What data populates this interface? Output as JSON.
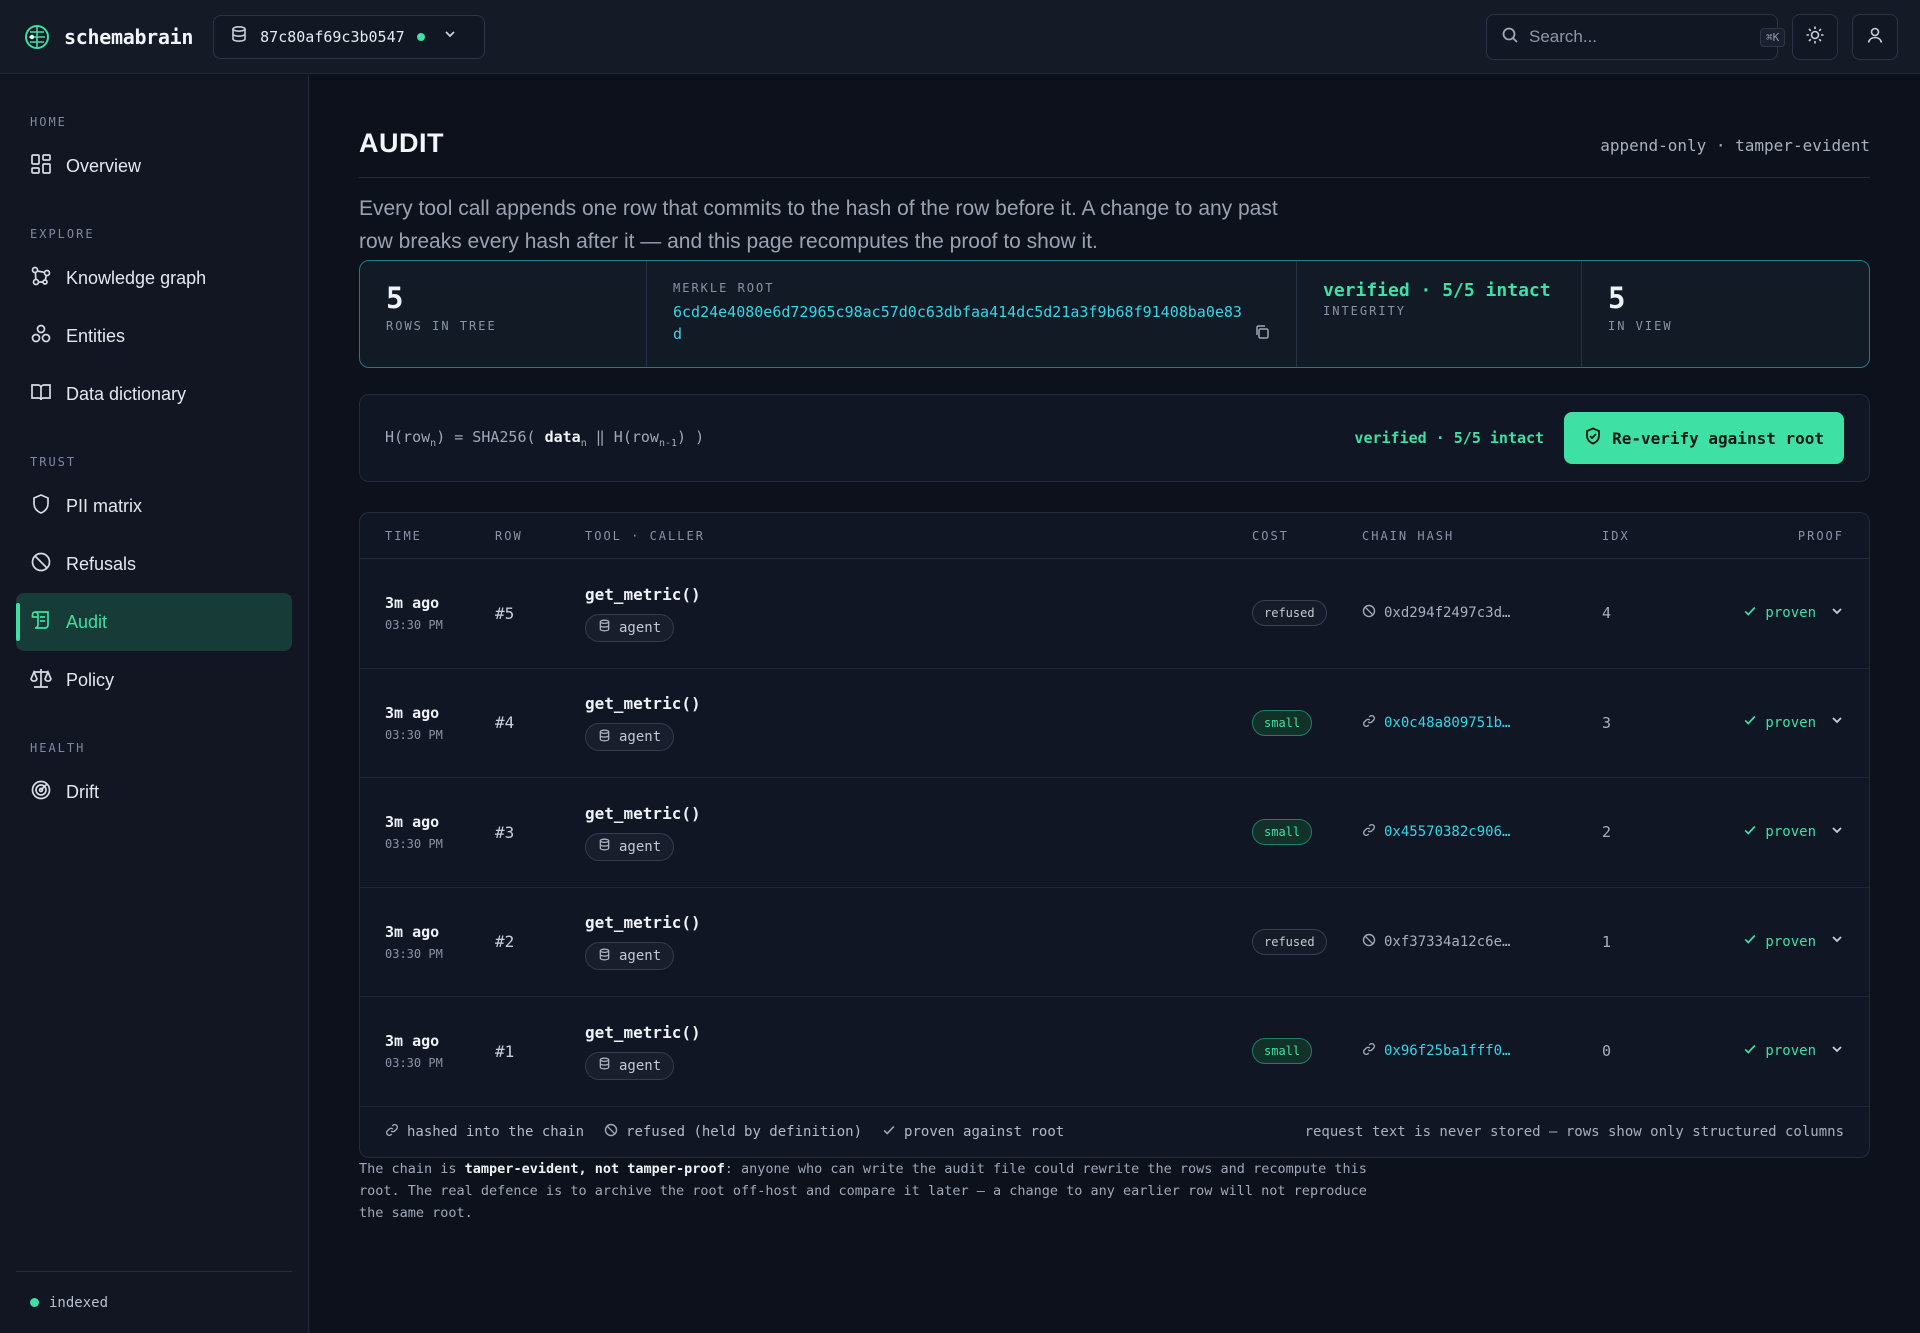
{
  "app": {
    "name": "schemabrain"
  },
  "database": {
    "id": "87c80af69c3b0547"
  },
  "search": {
    "placeholder": "Search...",
    "shortcut": "⌘K"
  },
  "sidebar": {
    "sections": [
      {
        "title": "HOME",
        "items": [
          {
            "label": "Overview",
            "icon": "grid-icon"
          }
        ]
      },
      {
        "title": "EXPLORE",
        "items": [
          {
            "label": "Knowledge graph",
            "icon": "graph-icon"
          },
          {
            "label": "Entities",
            "icon": "entities-icon"
          },
          {
            "label": "Data dictionary",
            "icon": "book-icon"
          }
        ]
      },
      {
        "title": "TRUST",
        "items": [
          {
            "label": "PII matrix",
            "icon": "shield-icon"
          },
          {
            "label": "Refusals",
            "icon": "ban-icon"
          },
          {
            "label": "Audit",
            "icon": "scroll-icon",
            "active": true
          },
          {
            "label": "Policy",
            "icon": "scale-icon"
          }
        ]
      },
      {
        "title": "HEALTH",
        "items": [
          {
            "label": "Drift",
            "icon": "radar-icon"
          }
        ]
      }
    ],
    "status": "indexed"
  },
  "page": {
    "title": "AUDIT",
    "tagline": "append-only · tamper-evident",
    "description": "Every tool call appends one row that commits to the hash of the row before it. A change to any past row breaks every hash after it — and this page recomputes the proof to show it."
  },
  "stats": {
    "rows": {
      "value": "5",
      "label": "ROWS IN TREE"
    },
    "merkle": {
      "label": "MERKLE ROOT",
      "value": "6cd24e4080e6d72965c98ac57d0c63dbfaa414dc5d21a3f9b68f91408ba0e83d"
    },
    "integrity": {
      "value": "verified · 5/5 intact",
      "label": "INTEGRITY"
    },
    "in_view": {
      "value": "5",
      "label": "IN VIEW"
    }
  },
  "formula": {
    "status": "verified · 5/5 intact",
    "button": "Re-verify against root"
  },
  "table": {
    "columns": {
      "time": "TIME",
      "row": "ROW",
      "tool": "TOOL · CALLER",
      "cost": "COST",
      "hash": "CHAIN HASH",
      "idx": "IDX",
      "proof": "PROOF"
    },
    "rows": [
      {
        "ago": "3m ago",
        "clock": "03:30 PM",
        "row": "#5",
        "tool": "get_metric()",
        "caller": "agent",
        "cost": "refused",
        "hash": "0xd294f2497c3d…",
        "idx": "4",
        "proof": "proven"
      },
      {
        "ago": "3m ago",
        "clock": "03:30 PM",
        "row": "#4",
        "tool": "get_metric()",
        "caller": "agent",
        "cost": "small",
        "hash": "0x0c48a809751b…",
        "idx": "3",
        "proof": "proven"
      },
      {
        "ago": "3m ago",
        "clock": "03:30 PM",
        "row": "#3",
        "tool": "get_metric()",
        "caller": "agent",
        "cost": "small",
        "hash": "0x45570382c906…",
        "idx": "2",
        "proof": "proven"
      },
      {
        "ago": "3m ago",
        "clock": "03:30 PM",
        "row": "#2",
        "tool": "get_metric()",
        "caller": "agent",
        "cost": "refused",
        "hash": "0xf37334a12c6e…",
        "idx": "1",
        "proof": "proven"
      },
      {
        "ago": "3m ago",
        "clock": "03:30 PM",
        "row": "#1",
        "tool": "get_metric()",
        "caller": "agent",
        "cost": "small",
        "hash": "0x96f25ba1fff0…",
        "idx": "0",
        "proof": "proven"
      }
    ]
  },
  "legend": {
    "chained": "hashed into the chain",
    "refused": "refused (held by definition)",
    "proven": "proven against root",
    "note": "request text is never stored — rows show only structured columns"
  },
  "footnote": {
    "prefix": "The chain is ",
    "emphasis": "tamper-evident, not tamper-proof",
    "rest": ": anyone who can write the audit file could rewrite the rows and recompute this root. The real defence is to archive the root off-host and compare it later — a change to any earlier row will not reproduce the same root."
  },
  "colors": {
    "accent": "#3ee0a3",
    "hash": "#35d6e6",
    "background": "#0d111c"
  }
}
